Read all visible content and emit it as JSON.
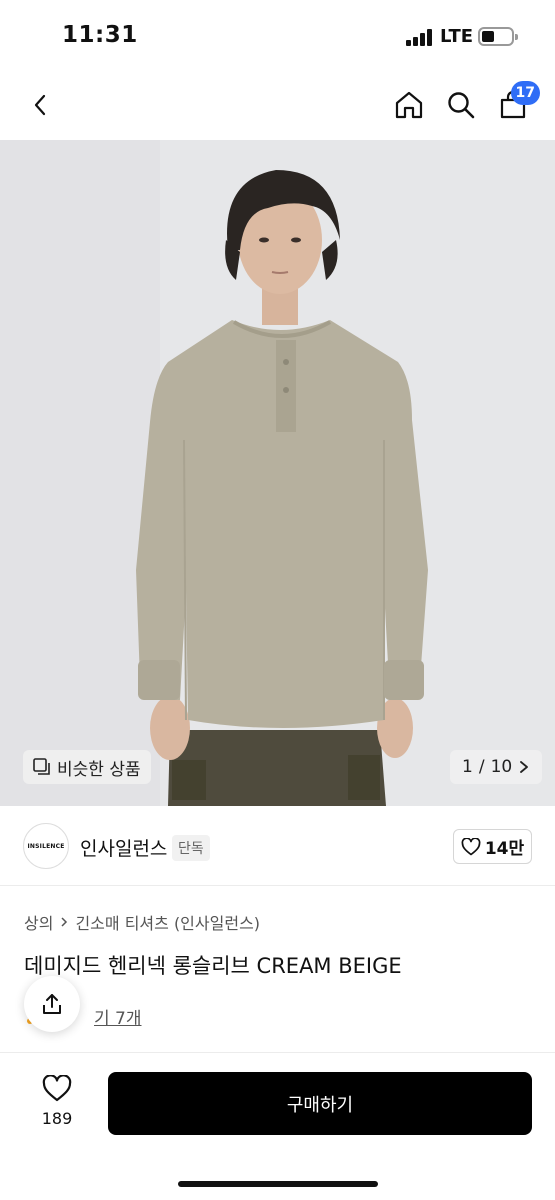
{
  "status_bar": {
    "time": "11:31",
    "network": "LTE"
  },
  "nav": {
    "back_icon": "chevron-left-icon",
    "home_icon": "home-icon",
    "search_icon": "search-icon",
    "cart_icon": "cart-icon",
    "cart_count": "17",
    "badge_color": "#2f6df6"
  },
  "gallery": {
    "similar_label": "비슷한 상품",
    "current_page": "1",
    "total_pages": "10",
    "page_separator": "/"
  },
  "brand": {
    "logo_text": "INSILENCE",
    "name": "인사일런스",
    "badge": "단독",
    "likes": "14만"
  },
  "product": {
    "breadcrumb": [
      "상의",
      "긴소매 티셔츠 (인사일런스)"
    ],
    "title": "데미지드 헨리넥 롱슬리브 CREAM BEIGE",
    "review_text": "후기 7개",
    "review_visible": "기 7개"
  },
  "bottom_bar": {
    "wish_count": "189",
    "buy_label": "구매하기"
  }
}
